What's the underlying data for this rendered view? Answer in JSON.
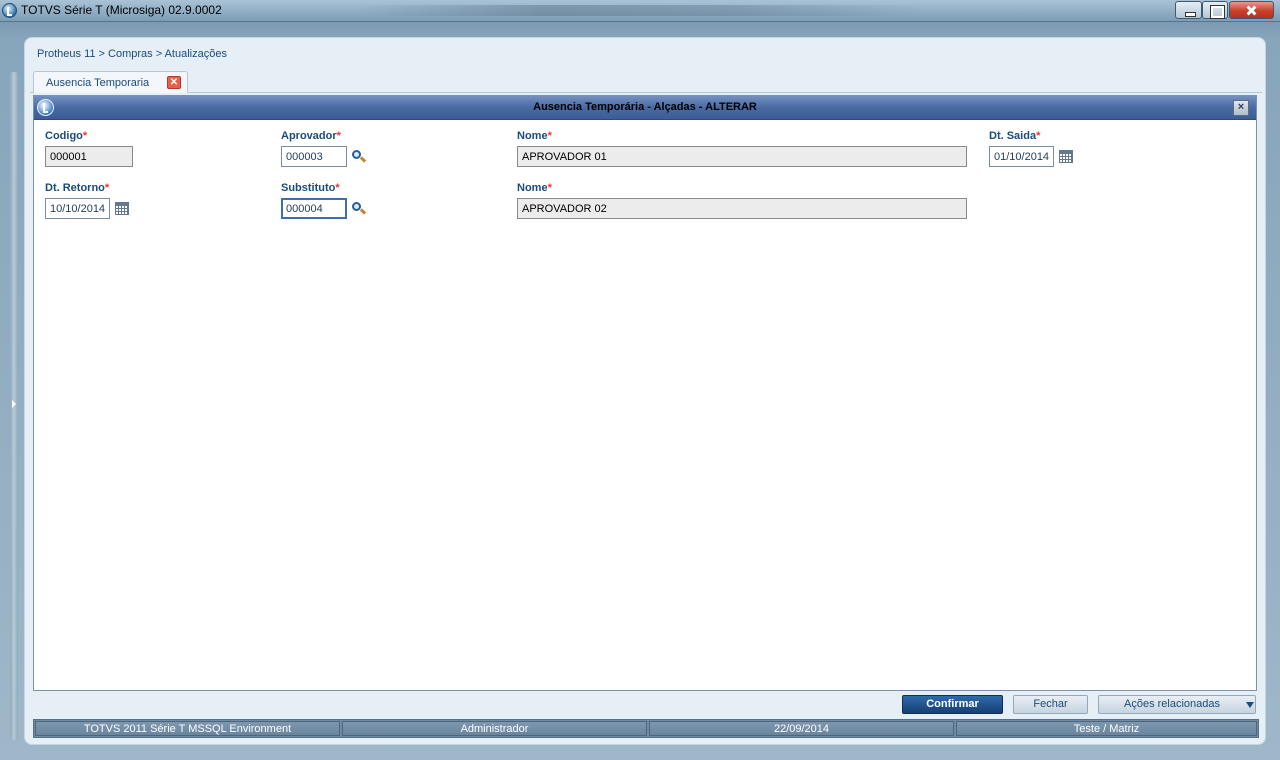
{
  "window": {
    "title": "TOTVS Série T  (Microsiga) 02.9.0002"
  },
  "breadcrumb": "Protheus 11 > Compras  > Atualizações",
  "tabs": [
    {
      "label": "Ausencia Temporaria",
      "close_icon": "close-icon"
    }
  ],
  "dialog": {
    "title": "Ausencia Temporária - Alçadas - ALTERAR",
    "close_glyph": "×",
    "fields": {
      "codigo": {
        "label": "Codigo",
        "required": "*",
        "value": "000001"
      },
      "aprovador": {
        "label": "Aprovador",
        "required": "*",
        "value": "000003"
      },
      "nome1": {
        "label": "Nome",
        "required": "*",
        "value": "APROVADOR 01"
      },
      "dt_saida": {
        "label": "Dt. Saida",
        "required": "*",
        "value": "01/10/2014"
      },
      "dt_retorno": {
        "label": "Dt. Retorno",
        "required": "*",
        "value": "10/10/2014"
      },
      "substituto": {
        "label": "Substituto",
        "required": "*",
        "value": "000004"
      },
      "nome2": {
        "label": "Nome",
        "required": "*",
        "value": "APROVADOR 02"
      }
    }
  },
  "buttons": {
    "confirm": "Confirmar",
    "close": "Fechar",
    "actions": "Ações relacionadas"
  },
  "status_bar": {
    "environment": "TOTVS 2011 Série T  MSSQL Environment",
    "user": "Administrador",
    "date": "22/09/2014",
    "branch": "Teste / Matriz"
  },
  "colors": {
    "label": "#1b4b7a",
    "required": "#e33333",
    "dialog_header": "#4a6aa3",
    "primary_button": "#163f73"
  }
}
